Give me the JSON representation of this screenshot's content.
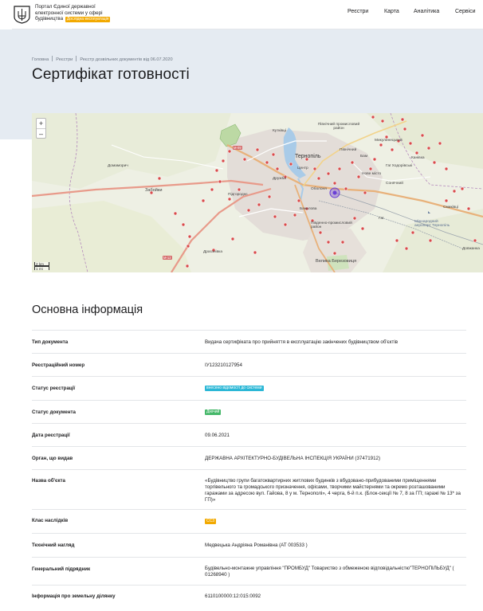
{
  "header": {
    "portal_line1": "Портал Єдиної державної",
    "portal_line2": "електронної системи у сфері",
    "portal_line3": "будівництва",
    "portal_badge": "Дослідна експлуатація",
    "nav": [
      "Реєстри",
      "Карта",
      "Аналітика",
      "Сервіси"
    ]
  },
  "breadcrumb": [
    "Головна",
    "Реєстри",
    "Реєстр дозвільних документів від 06.07.2020"
  ],
  "page_title": "Сертифікат готовності",
  "map": {
    "zoom_in": "+",
    "zoom_out": "–",
    "scale_km": "2 km",
    "scale_mi": "1 mi",
    "labels": {
      "city": "Тернопіль",
      "kutkivtsi": "Кутківці",
      "druzhba": "Дружба",
      "obolon": "Оболоня",
      "tsentr": "Центр",
      "north_industrial": "Північний промисловий район",
      "pivnichnyi": "Північний",
      "bam": "Бам",
      "nove_misto": "Нове місто",
      "hai_khodorivski": "Гаї Ходорівські",
      "kanyivka": "Канівка",
      "mykulynetsky": "Микулинецький",
      "mykulynetska": "Микулинецька",
      "sonyachnyi": "Сонячний",
      "bakalova": "Бакалова",
      "pivdennyi": "Південно-промисловий район",
      "hai": "Гаї",
      "smykovtsi": "Смиківці",
      "airport": "Міжнародний аеропорт Тернопіль",
      "dovzhanka": "Довжанка",
      "petrykiv": "Петриків",
      "pidhorodne": "Підгороднє",
      "zabovky": "Забойки",
      "domamorych": "Домаморич",
      "draganivka": "Драганівка",
      "velyka_berezovytsia": "Велика Березовиця",
      "road_m09": "M-09",
      "road_m12": "M-12",
      "smykivtsi_alt": "Смиківці"
    },
    "marker_color": "#d84a4a",
    "selected_color": "#6a3fd6"
  },
  "section_title": "Основна інформація",
  "info_rows": [
    {
      "key": "Тип документа",
      "value": "Видача сертифіката про прийняття в експлуатацію закінчених будівництвом об'єктів"
    },
    {
      "key": "Реєстраційний номер",
      "value": "IУ123210127954"
    },
    {
      "key": "Статус реєстрації",
      "value": "внесено відомості до системи",
      "tag": "cyan"
    },
    {
      "key": "Статус документа",
      "value": "Діючий",
      "tag": "green"
    },
    {
      "key": "Дата реєстрації",
      "value": "09.06.2021"
    },
    {
      "key": "Орган, що видав",
      "value": "ДЕРЖАВНА АРХІТЕКТУРНО-БУДІВЕЛЬНА ІНСПЕКЦІЯ УКРАЇНИ (37471912)"
    },
    {
      "key": "Назва об'єкта",
      "value": "«Будівництво групи багатоквартирних житлових будинків з вбудовано-прибудованими приміщеннями торгівельного та громадського призначення, офісами, творчими майстернями та окремо розташованими гаражами за адресою вул. Гайова, 8 у м. Тернополі», 4 черга, 6-й п.к. (Блок-секції № 7, 8 за ГП; гаражі № 13* за ГП)»"
    },
    {
      "key": "Клас наслідків",
      "value": "СС3",
      "tag": "orange"
    },
    {
      "key": "Технічний нагляд",
      "value": "Медвецька Андріяна Романівна (АТ 003533 )"
    },
    {
      "key": "Генеральний підрядник",
      "value": "Будівельно-монтажне управління \"ПРОМБУД\" Товариство з обмеженою відповідальністю\"ТЕРНОПІЛЬБУД\" ( 01268940 )"
    },
    {
      "key": "Інформація про земельну ділянку",
      "value": "6110100000:12:015:0092"
    }
  ]
}
